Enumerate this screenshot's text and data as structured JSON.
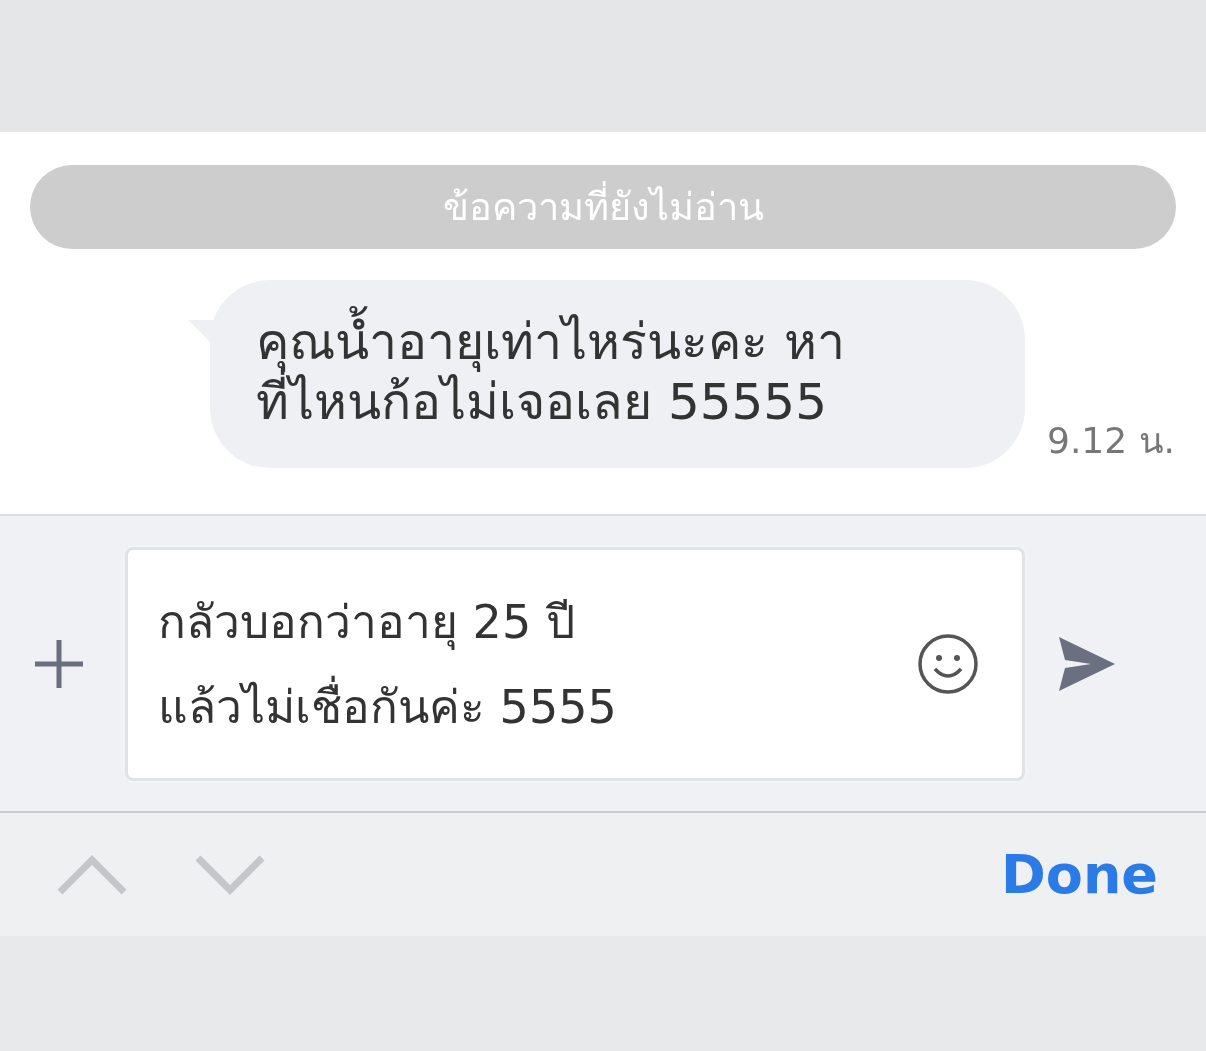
{
  "unread_divider": "ข้อความที่ยังไม่อ่าน",
  "messages": [
    {
      "text": "คุณน้ำอายุเท่าไหร่นะคะ หา\nที่ไหนก้อไม่เจอเลย 55555",
      "time": "9.12 น."
    }
  ],
  "composer": {
    "value": "กลัวบอกว่าอายุ 25 ปี\nแล้วไม่เชื่อกันค่ะ 5555"
  },
  "keyboard_toolbar": {
    "done": "Done"
  }
}
